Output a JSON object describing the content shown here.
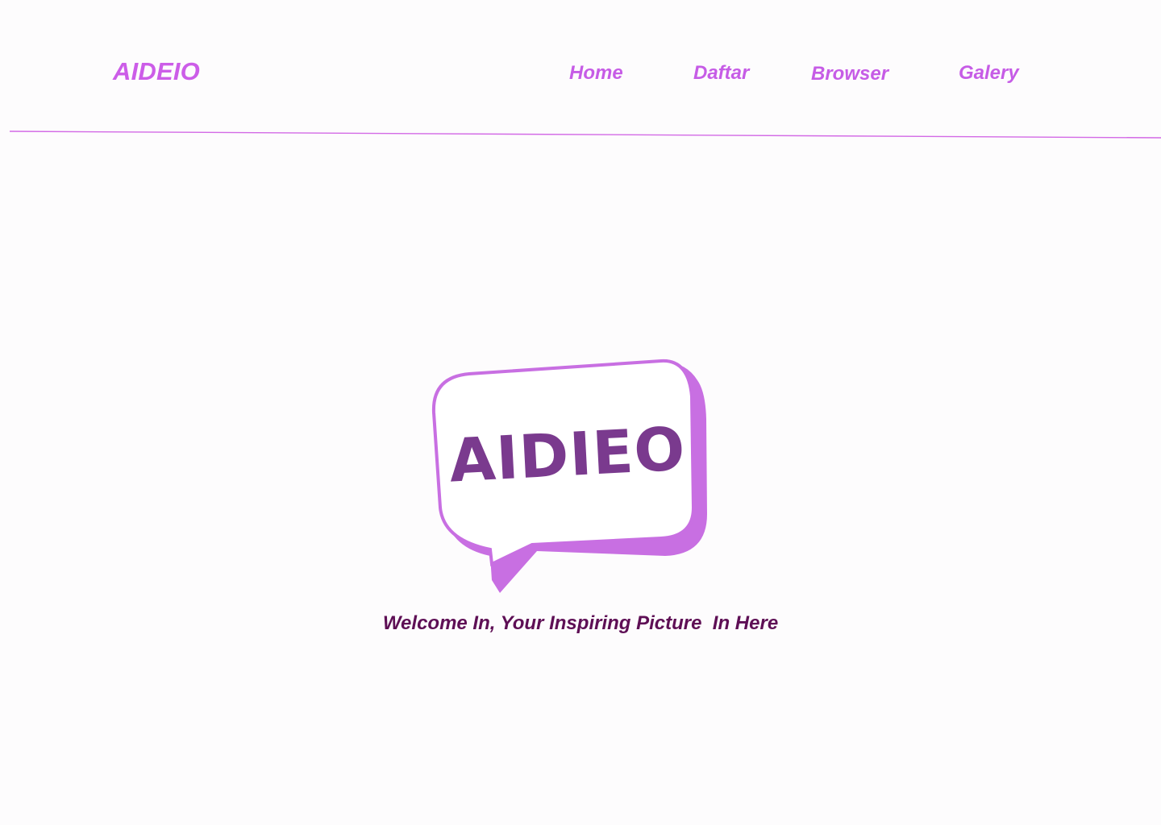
{
  "header": {
    "brand": "AIDEIO",
    "nav": {
      "home": "Home",
      "daftar": "Daftar",
      "browser": "Browser",
      "galery": "Galery"
    }
  },
  "hero": {
    "logo_text": "AIDIEO",
    "welcome": "Welcome In, Your Inspiring Picture  In Here"
  },
  "colors": {
    "accent": "#cc5de8",
    "logo_text": "#7a3a8e",
    "welcome_text": "#5e0f55",
    "background": "#fdfcfd"
  }
}
